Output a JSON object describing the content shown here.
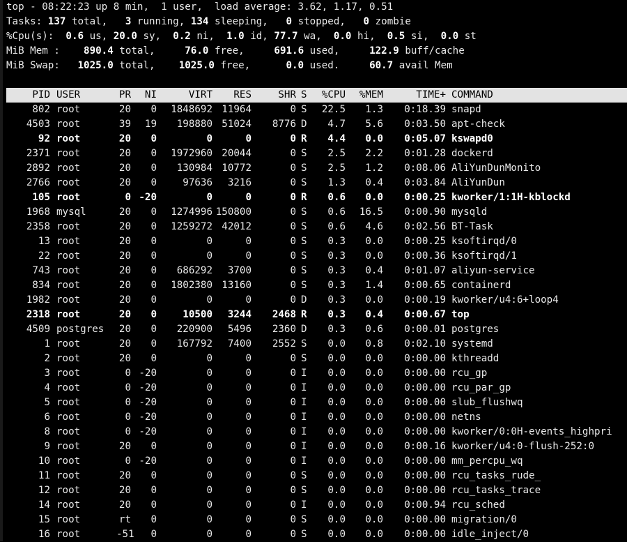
{
  "summary": {
    "uptime_prefix": "top - 08:22:23 up 8 min,  1 user,  load average: ",
    "load_avg": "3.62, 1.17, 0.51",
    "tasks_label": "Tasks: ",
    "tasks_total": "137",
    "tasks_total_lbl": " total,   ",
    "tasks_running": "3",
    "tasks_running_lbl": " running, ",
    "tasks_sleeping": "134",
    "tasks_sleeping_lbl": " sleeping,   ",
    "tasks_stopped": "0",
    "tasks_stopped_lbl": " stopped,   ",
    "tasks_zombie": "0",
    "tasks_zombie_lbl": " zombie",
    "cpu_label": "%Cpu(s):  ",
    "cpu_us": "0.6",
    "cpu_us_lbl": " us, ",
    "cpu_sy": "20.0",
    "cpu_sy_lbl": " sy,  ",
    "cpu_ni": "0.2",
    "cpu_ni_lbl": " ni,  ",
    "cpu_id": "1.0",
    "cpu_id_lbl": " id, ",
    "cpu_wa": "77.7",
    "cpu_wa_lbl": " wa,  ",
    "cpu_hi": "0.0",
    "cpu_hi_lbl": " hi,  ",
    "cpu_si": "0.5",
    "cpu_si_lbl": " si,  ",
    "cpu_st": "0.0",
    "cpu_st_lbl": " st",
    "mem_label": "MiB Mem :    ",
    "mem_total": "890.4",
    "mem_total_lbl": " total,     ",
    "mem_free": "76.0",
    "mem_free_lbl": " free,     ",
    "mem_used": "691.6",
    "mem_used_lbl": " used,     ",
    "mem_buff": "122.9",
    "mem_buff_lbl": " buff/cache",
    "swap_label": "MiB Swap:   ",
    "swap_total": "1025.0",
    "swap_total_lbl": " total,    ",
    "swap_free": "1025.0",
    "swap_free_lbl": " free,      ",
    "swap_used": "0.0",
    "swap_used_lbl": " used.     ",
    "swap_avail": "60.7",
    "swap_avail_lbl": " avail Mem"
  },
  "columns": [
    "PID",
    "USER",
    "PR",
    "NI",
    "VIRT",
    "RES",
    "SHR",
    "S",
    "%CPU",
    "%MEM",
    "TIME+",
    "COMMAND"
  ],
  "processes": [
    {
      "pid": "802",
      "user": "root",
      "pr": "20",
      "ni": "0",
      "virt": "1848692",
      "res": "11964",
      "shr": "0",
      "s": "S",
      "cpu": "22.5",
      "mem": "1.3",
      "time": "0:18.39",
      "cmd": "snapd",
      "bold": false
    },
    {
      "pid": "4503",
      "user": "root",
      "pr": "39",
      "ni": "19",
      "virt": "198880",
      "res": "51024",
      "shr": "8776",
      "s": "D",
      "cpu": "4.7",
      "mem": "5.6",
      "time": "0:03.50",
      "cmd": "apt-check",
      "bold": false
    },
    {
      "pid": "92",
      "user": "root",
      "pr": "20",
      "ni": "0",
      "virt": "0",
      "res": "0",
      "shr": "0",
      "s": "R",
      "cpu": "4.4",
      "mem": "0.0",
      "time": "0:05.07",
      "cmd": "kswapd0",
      "bold": true
    },
    {
      "pid": "2371",
      "user": "root",
      "pr": "20",
      "ni": "0",
      "virt": "1972960",
      "res": "20044",
      "shr": "0",
      "s": "S",
      "cpu": "2.5",
      "mem": "2.2",
      "time": "0:01.28",
      "cmd": "dockerd",
      "bold": false
    },
    {
      "pid": "2892",
      "user": "root",
      "pr": "20",
      "ni": "0",
      "virt": "130984",
      "res": "10772",
      "shr": "0",
      "s": "S",
      "cpu": "2.5",
      "mem": "1.2",
      "time": "0:08.06",
      "cmd": "AliYunDunMonito",
      "bold": false
    },
    {
      "pid": "2766",
      "user": "root",
      "pr": "20",
      "ni": "0",
      "virt": "97636",
      "res": "3216",
      "shr": "0",
      "s": "S",
      "cpu": "1.3",
      "mem": "0.4",
      "time": "0:03.84",
      "cmd": "AliYunDun",
      "bold": false
    },
    {
      "pid": "105",
      "user": "root",
      "pr": "0",
      "ni": "-20",
      "virt": "0",
      "res": "0",
      "shr": "0",
      "s": "R",
      "cpu": "0.6",
      "mem": "0.0",
      "time": "0:00.25",
      "cmd": "kworker/1:1H-kblockd",
      "bold": true
    },
    {
      "pid": "1968",
      "user": "mysql",
      "pr": "20",
      "ni": "0",
      "virt": "1274996",
      "res": "150800",
      "shr": "0",
      "s": "S",
      "cpu": "0.6",
      "mem": "16.5",
      "time": "0:00.90",
      "cmd": "mysqld",
      "bold": false
    },
    {
      "pid": "2358",
      "user": "root",
      "pr": "20",
      "ni": "0",
      "virt": "1259272",
      "res": "42012",
      "shr": "0",
      "s": "S",
      "cpu": "0.6",
      "mem": "4.6",
      "time": "0:02.56",
      "cmd": "BT-Task",
      "bold": false
    },
    {
      "pid": "13",
      "user": "root",
      "pr": "20",
      "ni": "0",
      "virt": "0",
      "res": "0",
      "shr": "0",
      "s": "S",
      "cpu": "0.3",
      "mem": "0.0",
      "time": "0:00.25",
      "cmd": "ksoftirqd/0",
      "bold": false
    },
    {
      "pid": "22",
      "user": "root",
      "pr": "20",
      "ni": "0",
      "virt": "0",
      "res": "0",
      "shr": "0",
      "s": "S",
      "cpu": "0.3",
      "mem": "0.0",
      "time": "0:00.36",
      "cmd": "ksoftirqd/1",
      "bold": false
    },
    {
      "pid": "743",
      "user": "root",
      "pr": "20",
      "ni": "0",
      "virt": "686292",
      "res": "3700",
      "shr": "0",
      "s": "S",
      "cpu": "0.3",
      "mem": "0.4",
      "time": "0:01.07",
      "cmd": "aliyun-service",
      "bold": false
    },
    {
      "pid": "834",
      "user": "root",
      "pr": "20",
      "ni": "0",
      "virt": "1802380",
      "res": "13160",
      "shr": "0",
      "s": "S",
      "cpu": "0.3",
      "mem": "1.4",
      "time": "0:00.65",
      "cmd": "containerd",
      "bold": false
    },
    {
      "pid": "1982",
      "user": "root",
      "pr": "20",
      "ni": "0",
      "virt": "0",
      "res": "0",
      "shr": "0",
      "s": "D",
      "cpu": "0.3",
      "mem": "0.0",
      "time": "0:00.19",
      "cmd": "kworker/u4:6+loop4",
      "bold": false
    },
    {
      "pid": "2318",
      "user": "root",
      "pr": "20",
      "ni": "0",
      "virt": "10500",
      "res": "3244",
      "shr": "2468",
      "s": "R",
      "cpu": "0.3",
      "mem": "0.4",
      "time": "0:00.67",
      "cmd": "top",
      "bold": true
    },
    {
      "pid": "4509",
      "user": "postgres",
      "pr": "20",
      "ni": "0",
      "virt": "220900",
      "res": "5496",
      "shr": "2360",
      "s": "D",
      "cpu": "0.3",
      "mem": "0.6",
      "time": "0:00.01",
      "cmd": "postgres",
      "bold": false
    },
    {
      "pid": "1",
      "user": "root",
      "pr": "20",
      "ni": "0",
      "virt": "167792",
      "res": "7400",
      "shr": "2552",
      "s": "S",
      "cpu": "0.0",
      "mem": "0.8",
      "time": "0:02.10",
      "cmd": "systemd",
      "bold": false
    },
    {
      "pid": "2",
      "user": "root",
      "pr": "20",
      "ni": "0",
      "virt": "0",
      "res": "0",
      "shr": "0",
      "s": "S",
      "cpu": "0.0",
      "mem": "0.0",
      "time": "0:00.00",
      "cmd": "kthreadd",
      "bold": false
    },
    {
      "pid": "3",
      "user": "root",
      "pr": "0",
      "ni": "-20",
      "virt": "0",
      "res": "0",
      "shr": "0",
      "s": "I",
      "cpu": "0.0",
      "mem": "0.0",
      "time": "0:00.00",
      "cmd": "rcu_gp",
      "bold": false
    },
    {
      "pid": "4",
      "user": "root",
      "pr": "0",
      "ni": "-20",
      "virt": "0",
      "res": "0",
      "shr": "0",
      "s": "I",
      "cpu": "0.0",
      "mem": "0.0",
      "time": "0:00.00",
      "cmd": "rcu_par_gp",
      "bold": false
    },
    {
      "pid": "5",
      "user": "root",
      "pr": "0",
      "ni": "-20",
      "virt": "0",
      "res": "0",
      "shr": "0",
      "s": "I",
      "cpu": "0.0",
      "mem": "0.0",
      "time": "0:00.00",
      "cmd": "slub_flushwq",
      "bold": false
    },
    {
      "pid": "6",
      "user": "root",
      "pr": "0",
      "ni": "-20",
      "virt": "0",
      "res": "0",
      "shr": "0",
      "s": "I",
      "cpu": "0.0",
      "mem": "0.0",
      "time": "0:00.00",
      "cmd": "netns",
      "bold": false
    },
    {
      "pid": "8",
      "user": "root",
      "pr": "0",
      "ni": "-20",
      "virt": "0",
      "res": "0",
      "shr": "0",
      "s": "I",
      "cpu": "0.0",
      "mem": "0.0",
      "time": "0:00.00",
      "cmd": "kworker/0:0H-events_highpri",
      "bold": false
    },
    {
      "pid": "9",
      "user": "root",
      "pr": "20",
      "ni": "0",
      "virt": "0",
      "res": "0",
      "shr": "0",
      "s": "I",
      "cpu": "0.0",
      "mem": "0.0",
      "time": "0:00.16",
      "cmd": "kworker/u4:0-flush-252:0",
      "bold": false
    },
    {
      "pid": "10",
      "user": "root",
      "pr": "0",
      "ni": "-20",
      "virt": "0",
      "res": "0",
      "shr": "0",
      "s": "I",
      "cpu": "0.0",
      "mem": "0.0",
      "time": "0:00.00",
      "cmd": "mm_percpu_wq",
      "bold": false
    },
    {
      "pid": "11",
      "user": "root",
      "pr": "20",
      "ni": "0",
      "virt": "0",
      "res": "0",
      "shr": "0",
      "s": "S",
      "cpu": "0.0",
      "mem": "0.0",
      "time": "0:00.00",
      "cmd": "rcu_tasks_rude_",
      "bold": false
    },
    {
      "pid": "12",
      "user": "root",
      "pr": "20",
      "ni": "0",
      "virt": "0",
      "res": "0",
      "shr": "0",
      "s": "S",
      "cpu": "0.0",
      "mem": "0.0",
      "time": "0:00.00",
      "cmd": "rcu_tasks_trace",
      "bold": false
    },
    {
      "pid": "14",
      "user": "root",
      "pr": "20",
      "ni": "0",
      "virt": "0",
      "res": "0",
      "shr": "0",
      "s": "I",
      "cpu": "0.0",
      "mem": "0.0",
      "time": "0:00.94",
      "cmd": "rcu_sched",
      "bold": false
    },
    {
      "pid": "15",
      "user": "root",
      "pr": "rt",
      "ni": "0",
      "virt": "0",
      "res": "0",
      "shr": "0",
      "s": "S",
      "cpu": "0.0",
      "mem": "0.0",
      "time": "0:00.00",
      "cmd": "migration/0",
      "bold": false
    },
    {
      "pid": "16",
      "user": "root",
      "pr": "-51",
      "ni": "0",
      "virt": "0",
      "res": "0",
      "shr": "0",
      "s": "S",
      "cpu": "0.0",
      "mem": "0.0",
      "time": "0:00.00",
      "cmd": "idle_inject/0",
      "bold": false
    }
  ],
  "colors": {
    "background": "#000000",
    "foreground": "#e8e8e8",
    "header_bar": "#e3e3e3",
    "header_text": "#000000"
  }
}
